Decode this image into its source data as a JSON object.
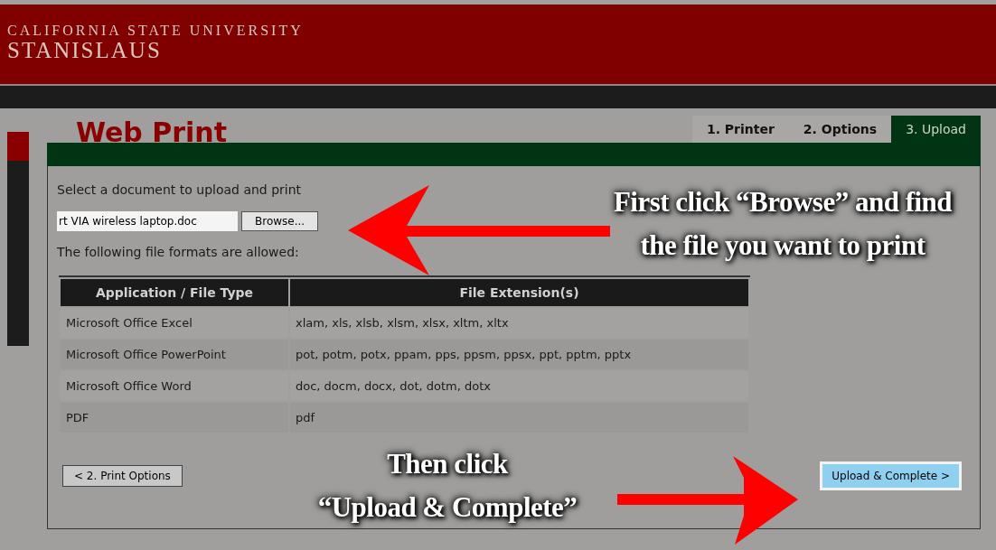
{
  "header": {
    "line1": "CALIFORNIA STATE UNIVERSITY",
    "line2": "STANISLAUS"
  },
  "page_title": "Web Print",
  "tabs": [
    {
      "label": "1. Printer",
      "selected": false
    },
    {
      "label": "2. Options",
      "selected": false
    },
    {
      "label": "3. Upload",
      "selected": true
    }
  ],
  "instruction": "Select a document to upload and print",
  "file_input": {
    "value": "rt VIA wireless laptop.doc"
  },
  "browse_button": "Browse...",
  "formats_label": "The following file formats are allowed:",
  "table": {
    "columns": [
      "Application / File Type",
      "File Extension(s)"
    ],
    "rows": [
      [
        "Microsoft Office Excel",
        "xlam, xls, xlsb, xlsm, xlsx, xltm, xltx"
      ],
      [
        "Microsoft Office PowerPoint",
        "pot, potm, potx, ppam, pps, ppsm, ppsx, ppt, pptm, pptx"
      ],
      [
        "Microsoft Office Word",
        "doc, docm, docx, dot, dotm, dotx"
      ],
      [
        "PDF",
        "pdf"
      ]
    ]
  },
  "back_button": "< 2. Print Options",
  "submit_button": "Upload & Complete >",
  "annotations": [
    {
      "kind": "left",
      "lines": [
        "First click “Browse” and find",
        "the file you want to print"
      ]
    },
    {
      "kind": "right",
      "lines": [
        "Then click",
        "“Upload & Complete”"
      ]
    }
  ]
}
